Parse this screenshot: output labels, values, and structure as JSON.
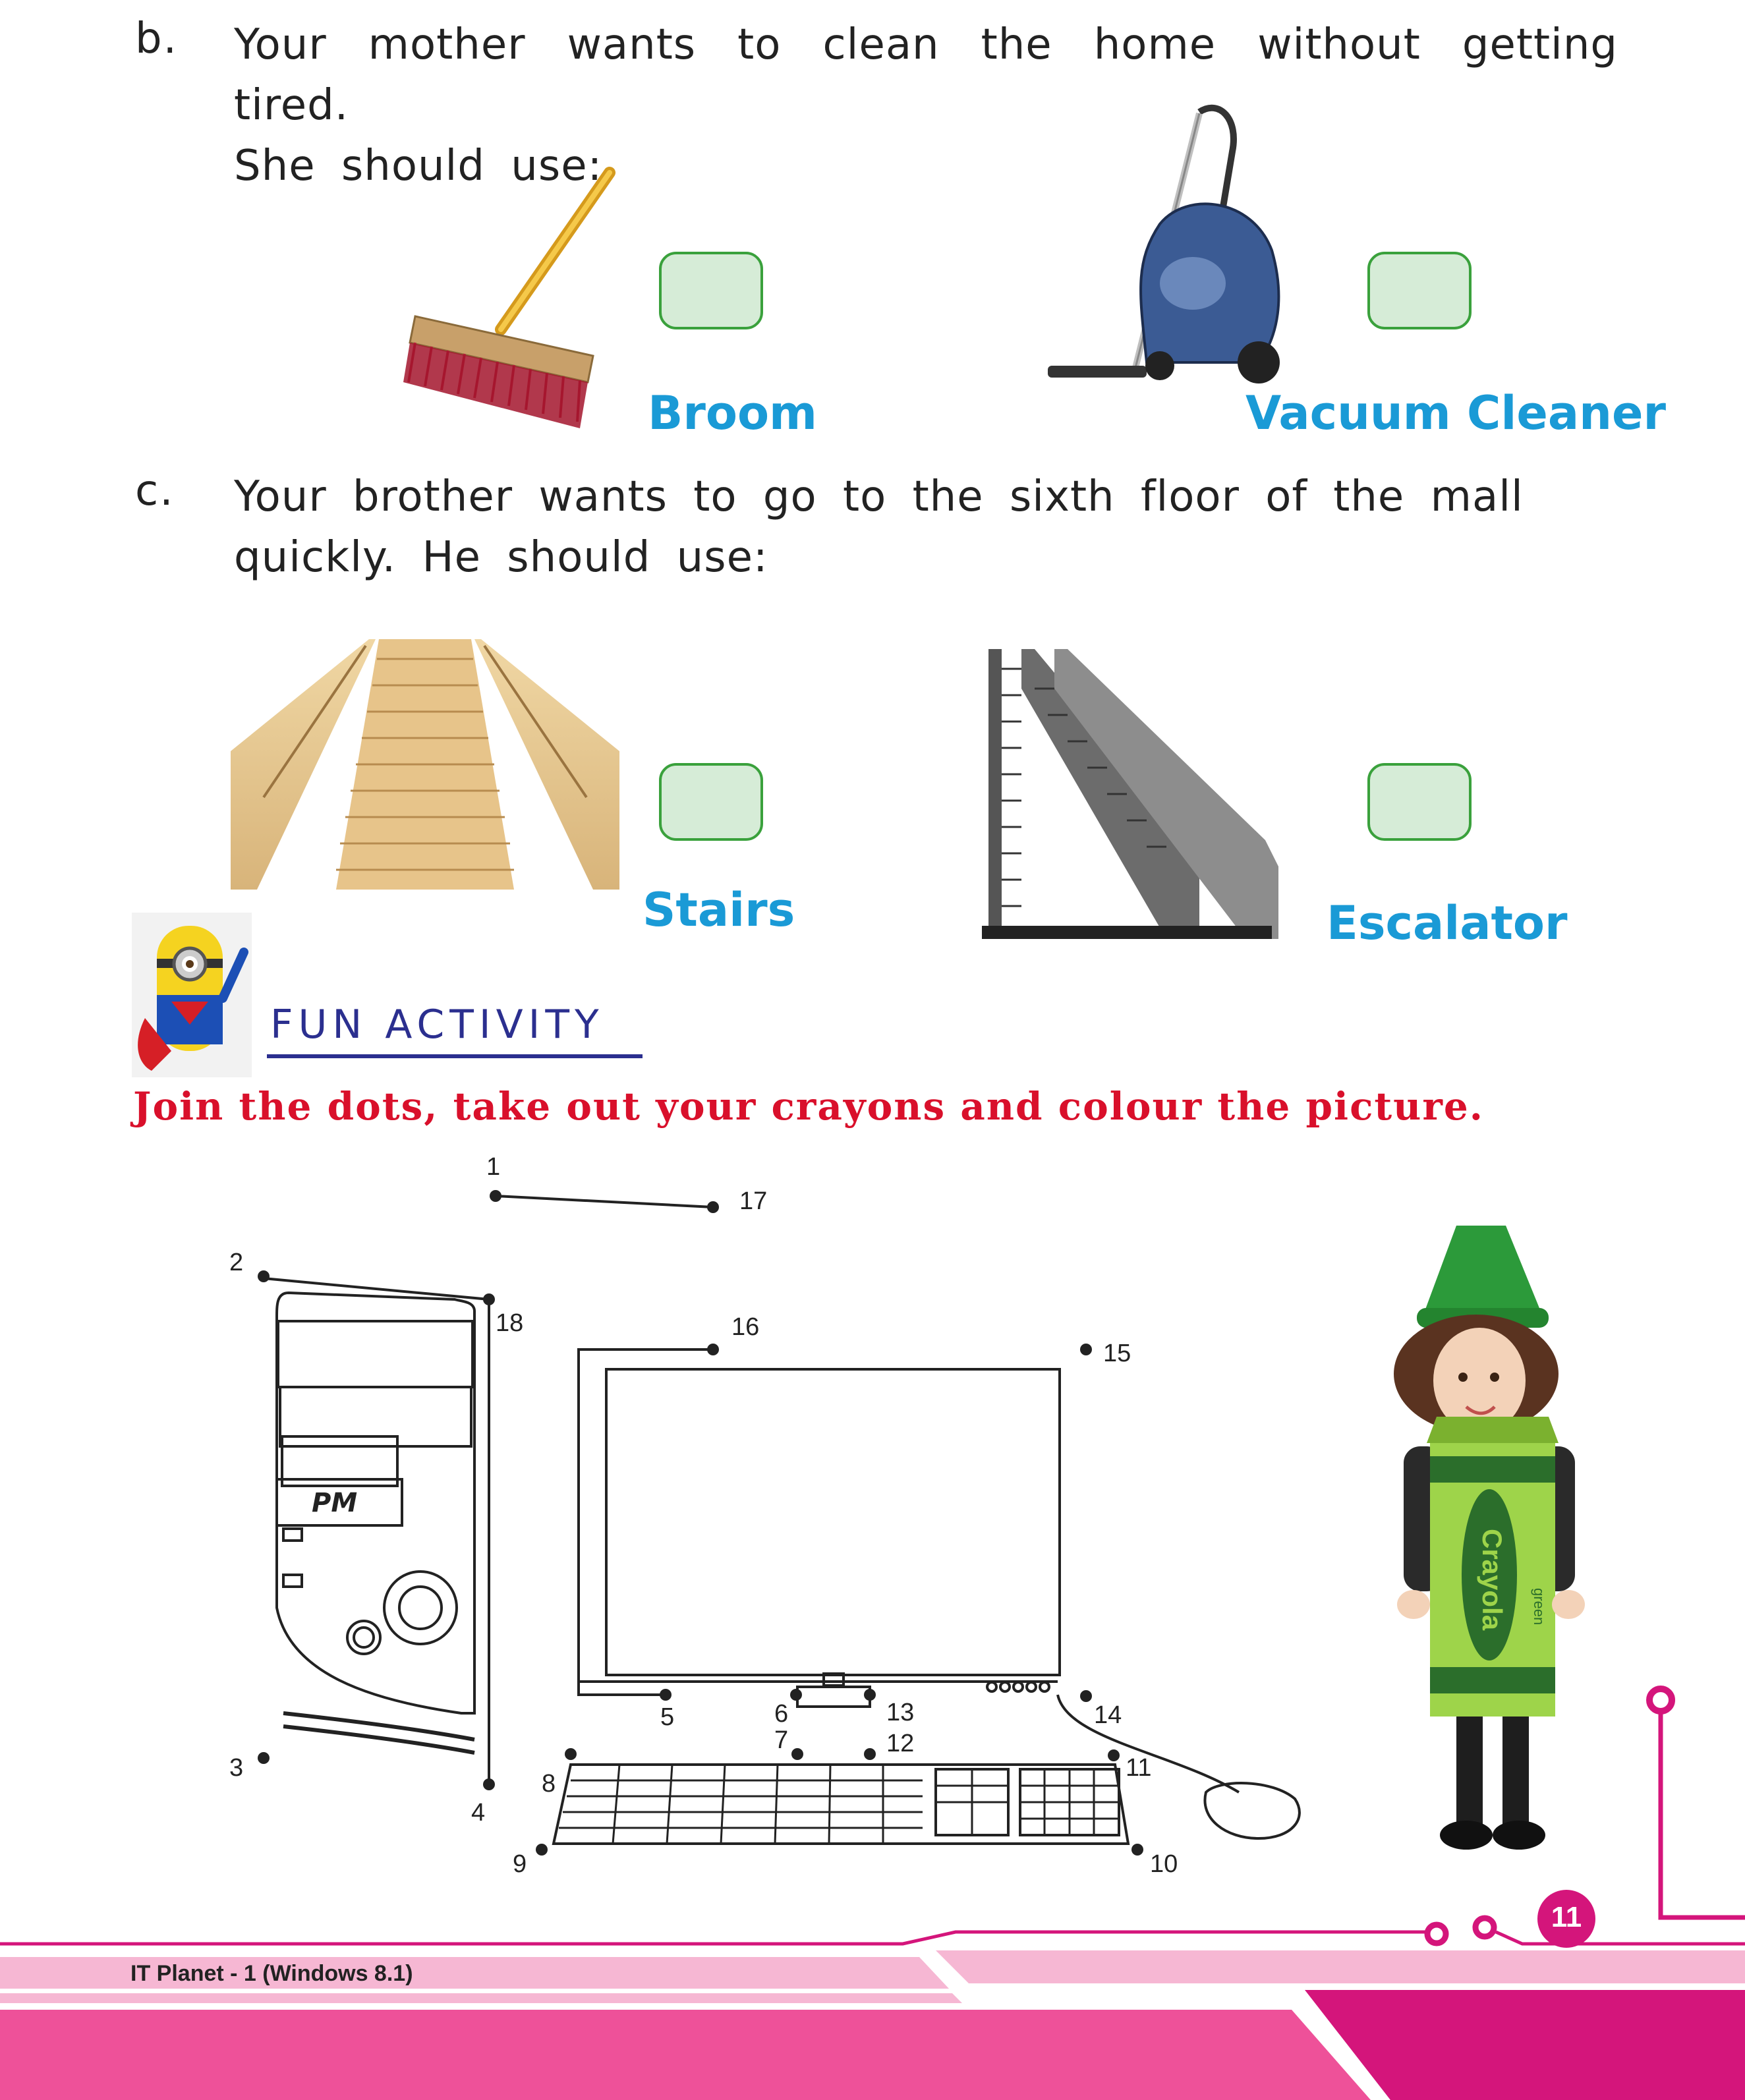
{
  "question_b": {
    "letter": "b.",
    "line1": "Your mother wants to clean the home without getting tired.",
    "line2": "She should use:",
    "option1": "Broom",
    "option2": "Vacuum Cleaner"
  },
  "question_c": {
    "letter": "c.",
    "line1": "Your brother wants to go to the sixth floor of the mall",
    "line2": "quickly. He should use:",
    "option1": "Stairs",
    "option2": "Escalator"
  },
  "fun_activity": {
    "title": "FUN ACTIVITY",
    "instruction": "Join the dots, take out your crayons and colour the picture.",
    "cpu_label": "PM",
    "crayon_brand": "Crayola",
    "crayon_color": "green",
    "dot_numbers": [
      "1",
      "2",
      "3",
      "4",
      "5",
      "6",
      "7",
      "8",
      "9",
      "10",
      "11",
      "12",
      "13",
      "14",
      "15",
      "16",
      "17",
      "18"
    ]
  },
  "footer": {
    "book_title": "IT Planet - 1 (Windows 8.1)",
    "page_number": "11"
  },
  "colors": {
    "label_blue": "#1a9ad6",
    "checkbox_green": "#3aa13c",
    "instruction_red": "#d9102b",
    "title_navy": "#2b2f8f",
    "footer_magenta": "#d4157b",
    "footer_pink": "#f6b7d3"
  }
}
